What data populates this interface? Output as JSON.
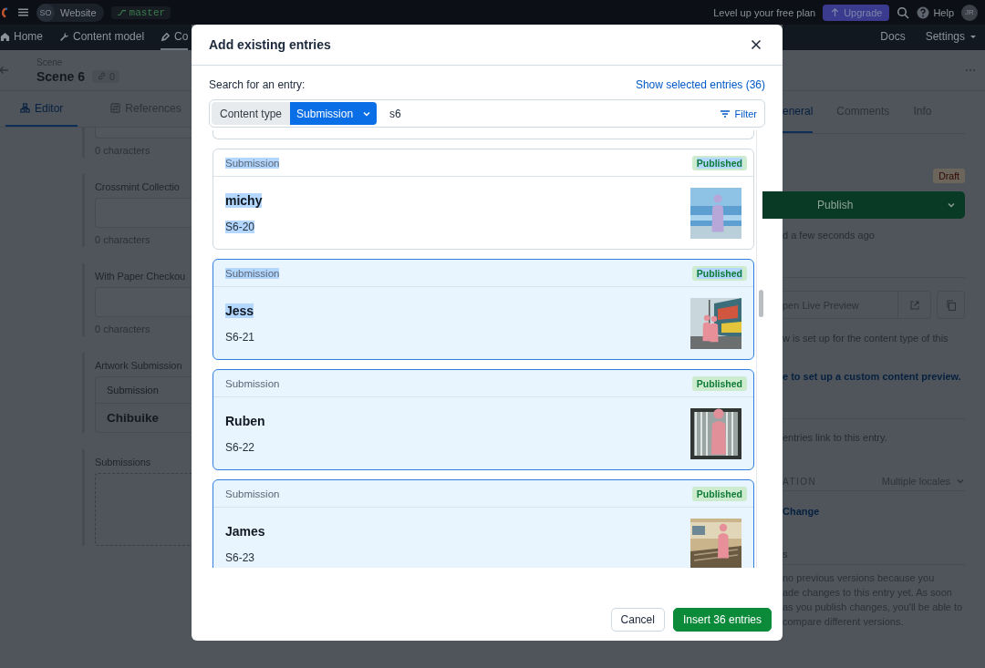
{
  "top_bar": {
    "space_initials": "SO",
    "space_name": "Website",
    "branch": "master",
    "upgrade_prompt": "Level up your free plan",
    "upgrade_button": "Upgrade",
    "help": "Help",
    "user_initials": "JR"
  },
  "nav": {
    "left": [
      {
        "label": "Home",
        "selected": false
      },
      {
        "label": "Content model",
        "selected": false
      },
      {
        "label": "Co",
        "selected": true
      }
    ],
    "right": [
      {
        "label": "Docs",
        "dropdown": false
      },
      {
        "label": "Settings",
        "dropdown": true
      }
    ]
  },
  "entry": {
    "content_type": "Scene",
    "title": "Scene 6",
    "link_count": "0"
  },
  "editor_tabs": [
    {
      "label": "Editor",
      "selected": true
    },
    {
      "label": "References",
      "selected": false
    }
  ],
  "fields": [
    {
      "kind": "text",
      "counter": "0 characters"
    },
    {
      "kind": "text",
      "label": "Crossmint Collectio",
      "counter": "0 characters"
    },
    {
      "kind": "text",
      "label": "With Paper Checkou",
      "counter": "0 characters"
    },
    {
      "kind": "reference",
      "label": "Artwork Submission",
      "card": {
        "type": "Submission",
        "title": "Chibuike"
      }
    },
    {
      "kind": "references",
      "label": "Submissions"
    }
  ],
  "sidebar": {
    "tabs": [
      {
        "label": "eneral",
        "selected": true
      },
      {
        "label": "Comments",
        "selected": false
      },
      {
        "label": "Info",
        "selected": false
      }
    ],
    "status": "Draft",
    "publish_button": "Publish",
    "saved_note": "d a few seconds ago",
    "preview_button": "pen Live Preview",
    "preview_note": "w is set up for the content type of this",
    "preview_link": "e to set up a custom content preview.",
    "links_note": "entries link to this entry.",
    "translation_heading": "ATION",
    "locale_select": "Multiple locales",
    "change_link": "Change",
    "versions_heading": "s",
    "versions_note": [
      "no previous versions because you",
      "ade changes to this entry yet. As soon",
      "as you publish changes, you'll be able to",
      "compare different versions."
    ]
  },
  "modal": {
    "title": "Add existing entries",
    "search_label": "Search for an entry:",
    "show_selected_link": "Show selected entries (36)",
    "content_type_label": "Content type",
    "content_type_value": "Submission",
    "query": "s6",
    "filter_button": "Filter",
    "entries": [
      {
        "type": "Submission",
        "status": "Published",
        "title": "michy",
        "code": "S6-20",
        "selected": false,
        "highlighted": {
          "type": true,
          "status": true,
          "title": true,
          "code": true
        }
      },
      {
        "type": "Submission",
        "status": "Published",
        "title": "Jess",
        "code": "S6-21",
        "selected": true,
        "highlighted": {
          "type": true,
          "status": true,
          "title": true,
          "code": false
        }
      },
      {
        "type": "Submission",
        "status": "Published",
        "title": "Ruben",
        "code": "S6-22",
        "selected": true,
        "highlighted": {
          "type": false,
          "status": false,
          "title": false,
          "code": false
        }
      },
      {
        "type": "Submission",
        "status": "Published",
        "title": "James",
        "code": "S6-23",
        "selected": true,
        "highlighted": {
          "type": false,
          "status": false,
          "title": false,
          "code": false
        }
      }
    ],
    "cancel_button": "Cancel",
    "insert_button": "Insert 36 entries"
  }
}
